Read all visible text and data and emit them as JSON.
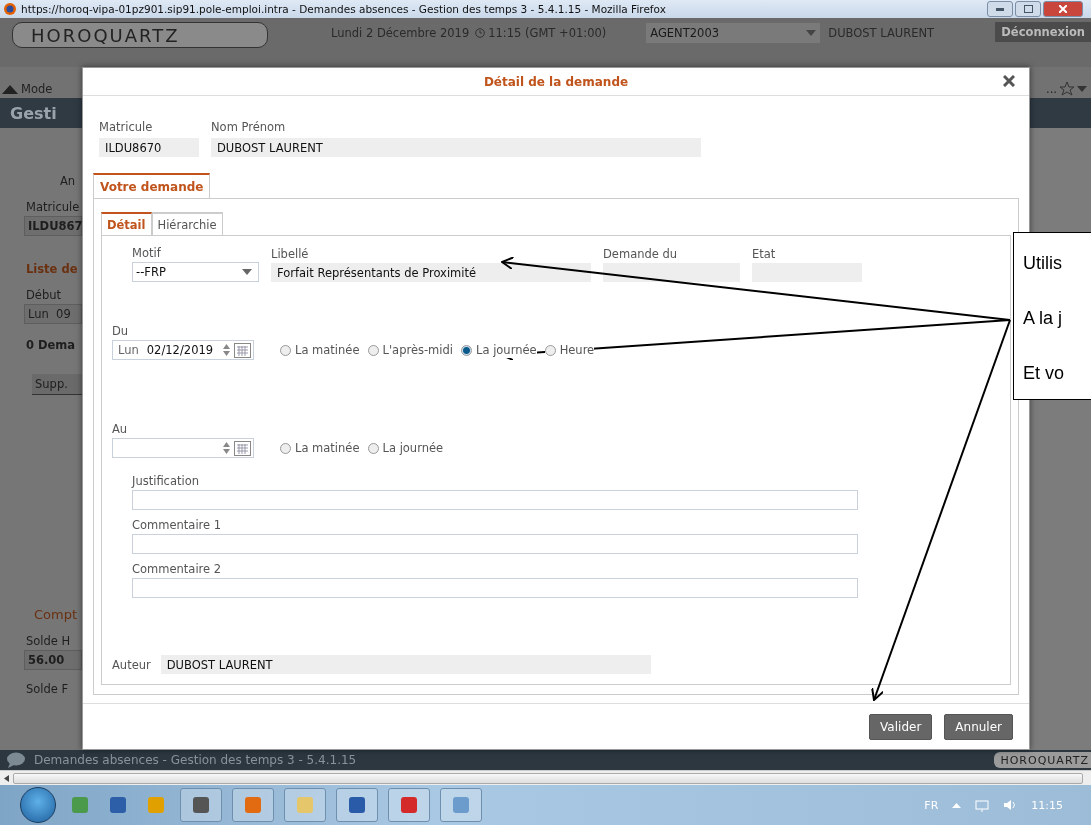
{
  "browser": {
    "title": "https://horoq-vipa-01pz901.sip91.pole-emploi.intra - Demandes absences - Gestion des temps 3 - 5.4.1.15 - Mozilla Firefox"
  },
  "header": {
    "logo": "HOROQUARTZ",
    "date": "Lundi 2 Décembre 2019",
    "time": "11:15 (GMT +01:00)",
    "agent": "AGENT2003",
    "user": "DUBOST LAURENT",
    "logout": "Déconnexion"
  },
  "toolbar": {
    "mode": "Mode",
    "more": "..."
  },
  "page_title": "Gesti",
  "background_panel": [
    {
      "kind": "tool",
      "text": "An"
    },
    {
      "kind": "label",
      "text": "Matricule"
    },
    {
      "kind": "value",
      "text": "ILDU867"
    },
    {
      "kind": "heading",
      "text": "Liste de"
    },
    {
      "kind": "label",
      "text": "Début"
    },
    {
      "kind": "field",
      "text": "Lun  09"
    },
    {
      "kind": "count",
      "text": "0 Dema"
    },
    {
      "kind": "grid",
      "text": "Supp."
    },
    {
      "kind": "section",
      "text": "Compt"
    },
    {
      "kind": "label",
      "text": "Solde H"
    },
    {
      "kind": "value",
      "text": "56.00"
    },
    {
      "kind": "label",
      "text": "Solde F"
    }
  ],
  "dialog": {
    "title": "Détail de la demande",
    "matricule": {
      "label": "Matricule",
      "value": "ILDU8670"
    },
    "name": {
      "label": "Nom Prénom",
      "value": "DUBOST LAURENT"
    },
    "tabs": [
      {
        "label": "Votre demande",
        "selected": true
      }
    ],
    "subtabs": [
      {
        "label": "Détail",
        "selected": true
      },
      {
        "label": "Hiérarchie",
        "selected": false
      }
    ],
    "motif": {
      "label": "Motif",
      "value": "--FRP"
    },
    "libelle": {
      "label": "Libellé",
      "value": "Forfait Représentants de Proximité"
    },
    "demande_du": {
      "label": "Demande du"
    },
    "etat": {
      "label": "Etat"
    },
    "du": {
      "label": "Du",
      "day": "Lun",
      "date": "02/12/2019",
      "options": [
        {
          "label": "La matinée",
          "selected": false
        },
        {
          "label": "L'après-midi",
          "selected": false
        },
        {
          "label": "La journée",
          "selected": true
        },
        {
          "label": "Heure",
          "selected": false
        }
      ]
    },
    "au": {
      "label": "Au",
      "options": [
        {
          "label": "La matinée",
          "selected": false
        },
        {
          "label": "La journée",
          "selected": false
        }
      ]
    },
    "text_fields": [
      {
        "label": "Justification"
      },
      {
        "label": "Commentaire 1"
      },
      {
        "label": "Commentaire 2"
      }
    ],
    "author": {
      "label": "Auteur",
      "value": "DUBOST LAURENT"
    },
    "buttons": [
      "Valider",
      "Annuler"
    ]
  },
  "callout": {
    "lines": [
      "Utilis",
      "A la j",
      "Et vo"
    ]
  },
  "status_bar": {
    "text": "Demandes absences - Gestion des temps 3 - 5.4.1.15",
    "logo": "HOROQUARTZ"
  },
  "taskbar": {
    "language": "FR",
    "clock": "11:15"
  }
}
